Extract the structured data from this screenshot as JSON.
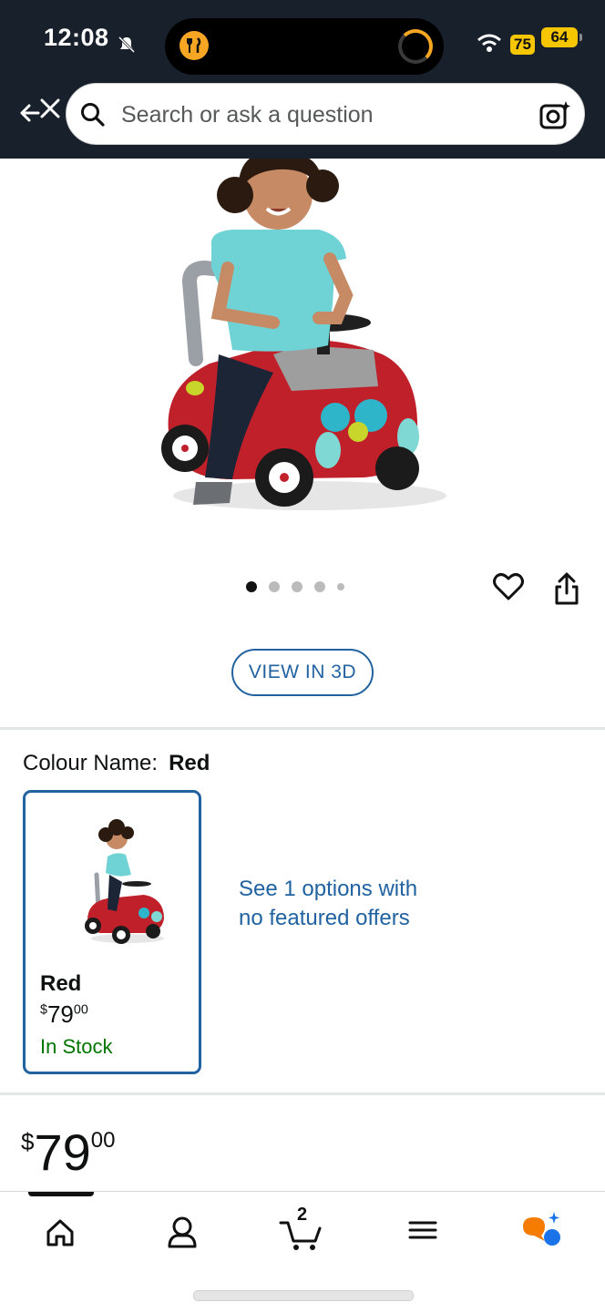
{
  "status_bar": {
    "time": "12:08",
    "badge": "75",
    "battery": "64"
  },
  "search": {
    "placeholder": "Search or ask a question"
  },
  "product": {
    "view_3d_label": "VIEW IN 3D",
    "image_count": 5,
    "active_image": 1
  },
  "colour": {
    "label": "Colour Name:",
    "value": "Red",
    "card": {
      "title": "Red",
      "currency": "$",
      "price_whole": "79",
      "price_fraction": "00",
      "stock": "In Stock"
    },
    "see_options": "See 1 options with no featured offers"
  },
  "price": {
    "currency": "$",
    "whole": "79",
    "fraction": "00"
  },
  "bottom_nav": {
    "cart_count": "2"
  },
  "colors": {
    "header_bg": "#18212b",
    "link": "#2162a1",
    "in_stock": "#007600",
    "rufus_orange": "#f57c00",
    "rufus_blue": "#1a73e8"
  }
}
